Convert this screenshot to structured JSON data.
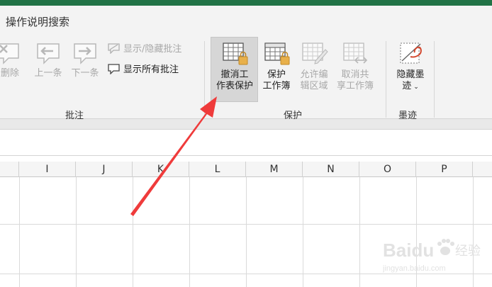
{
  "tellme": {
    "label": "操作说明搜索"
  },
  "comments_group": {
    "label": "批注",
    "delete_label": "删除",
    "prev_label": "上一条",
    "next_label": "下一条",
    "show_hide_label": "显示/隐藏批注",
    "show_all_label": "显示所有批注"
  },
  "protect_group": {
    "label": "保护",
    "unprotect_sheet": {
      "line1": "撤消工",
      "line2": "作表保护"
    },
    "protect_workbook": {
      "line1": "保护",
      "line2": "工作簿"
    },
    "allow_edit_ranges": {
      "line1": "允许编",
      "line2": "辑区域"
    },
    "unshare_workbook": {
      "line1": "取消共",
      "line2": "享工作簿"
    }
  },
  "ink_group": {
    "label": "墨迹",
    "hide_ink": {
      "line1": "隐藏墨",
      "line2": "迹"
    }
  },
  "columns": [
    "I",
    "J",
    "K",
    "L",
    "M",
    "N",
    "O",
    "P"
  ],
  "watermark": {
    "brand": "Baidu",
    "brand_cn": "经验",
    "site": "jingyan.baidu.com"
  },
  "colors": {
    "title_bar": "#217346",
    "ribbon_bg": "#f3f3f3",
    "arrow": "#ef3b3b",
    "selected_btn": "#d6d6d6"
  }
}
